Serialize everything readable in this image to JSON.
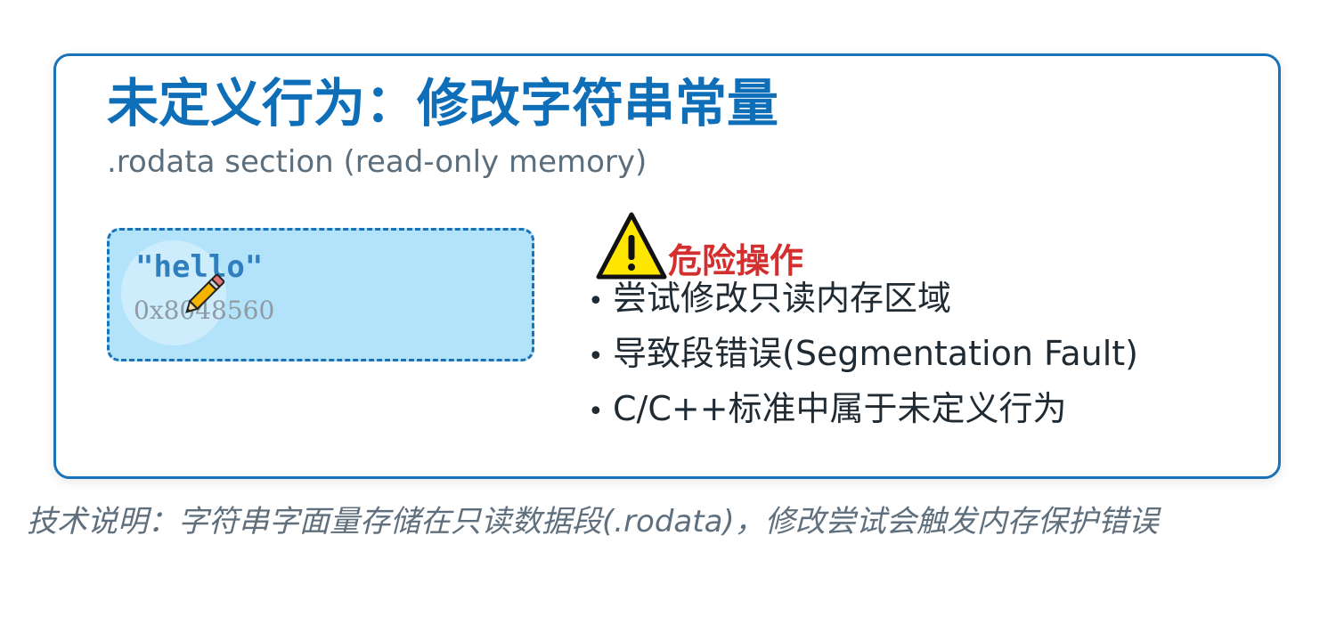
{
  "header": {
    "title": "未定义行为：修改字符串常量",
    "subtitle": ".rodata section (read-only memory)"
  },
  "memory_block": {
    "string_literal": "\"hello\"",
    "address": "0x8048560"
  },
  "warning": {
    "label": "危险操作",
    "icon": "warning-triangle-icon"
  },
  "points": [
    "尝试修改只读内存区域",
    "导致段错误(Segmentation Fault)",
    "C/C++标准中属于未定义行为"
  ],
  "footnote": "技术说明：字符串字面量存储在只读数据段(.rodata)，修改尝试会触发内存保护错误",
  "colors": {
    "accent": "#0f6eb8",
    "border": "#1a73b8",
    "memory_fill": "#b3e3fa",
    "danger": "#d32f2f",
    "warning_yellow": "#ffe600"
  }
}
